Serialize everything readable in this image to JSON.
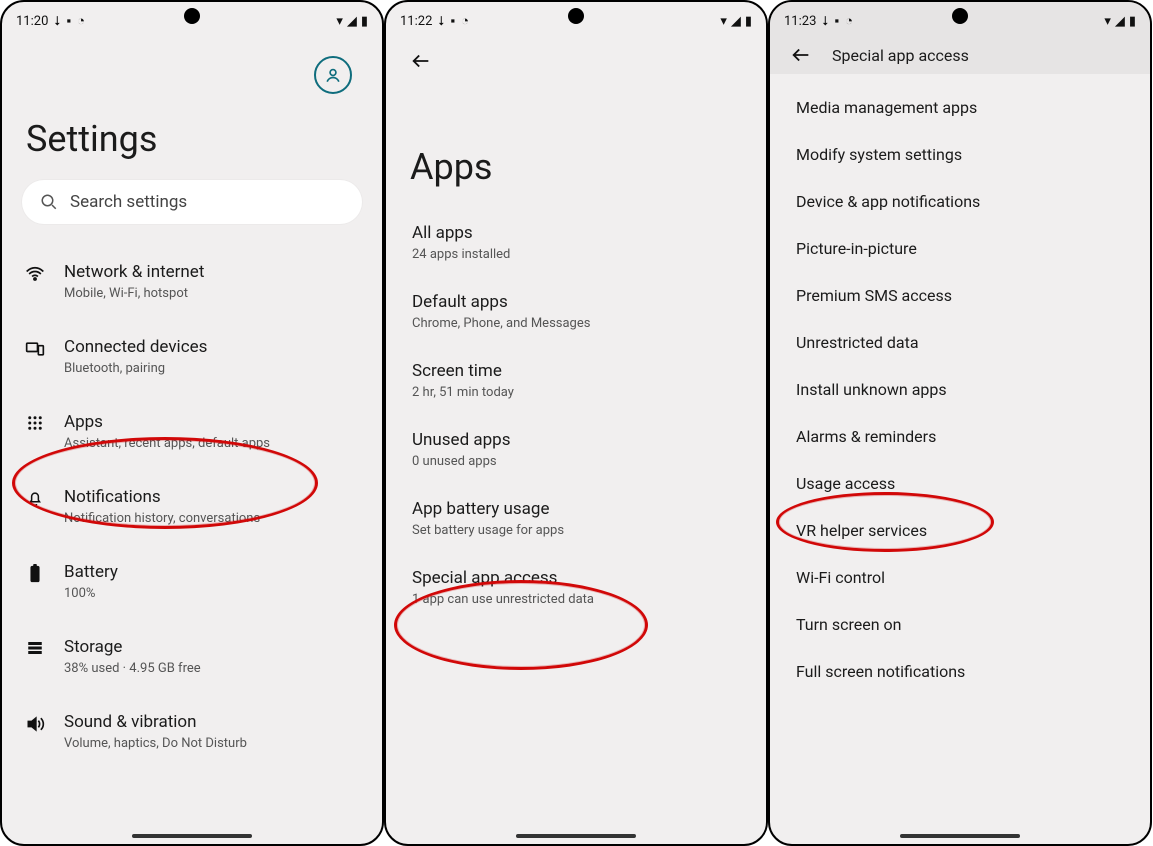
{
  "statusbar": {
    "times": [
      "11:20",
      "11:22",
      "11:23"
    ],
    "icons_left": [
      "download-icon",
      "android-icon",
      "clock-icon"
    ],
    "icons_right": [
      "wifi-icon",
      "signal-icon",
      "battery-icon"
    ]
  },
  "screen1": {
    "title": "Settings",
    "search_placeholder": "Search settings",
    "items": [
      {
        "icon": "wifi",
        "title": "Network & internet",
        "sub": "Mobile, Wi-Fi, hotspot"
      },
      {
        "icon": "devices",
        "title": "Connected devices",
        "sub": "Bluetooth, pairing"
      },
      {
        "icon": "apps",
        "title": "Apps",
        "sub": "Assistant, recent apps, default apps"
      },
      {
        "icon": "bell",
        "title": "Notifications",
        "sub": "Notification history, conversations"
      },
      {
        "icon": "battery",
        "title": "Battery",
        "sub": "100%"
      },
      {
        "icon": "storage",
        "title": "Storage",
        "sub": "38% used · 4.95 GB free"
      },
      {
        "icon": "sound",
        "title": "Sound & vibration",
        "sub": "Volume, haptics, Do Not Disturb"
      }
    ]
  },
  "screen2": {
    "title": "Apps",
    "items": [
      {
        "title": "All apps",
        "sub": "24 apps installed"
      },
      {
        "title": "Default apps",
        "sub": "Chrome, Phone, and Messages"
      },
      {
        "title": "Screen time",
        "sub": "2 hr, 51 min today"
      },
      {
        "title": "Unused apps",
        "sub": "0 unused apps"
      },
      {
        "title": "App battery usage",
        "sub": "Set battery usage for apps"
      },
      {
        "title": "Special app access",
        "sub": "1 app can use unrestricted data"
      }
    ]
  },
  "screen3": {
    "title": "Special app access",
    "items": [
      "Media management apps",
      "Modify system settings",
      "Device & app notifications",
      "Picture-in-picture",
      "Premium SMS access",
      "Unrestricted data",
      "Install unknown apps",
      "Alarms & reminders",
      "Usage access",
      "VR helper services",
      "Wi-Fi control",
      "Turn screen on",
      "Full screen notifications"
    ]
  }
}
